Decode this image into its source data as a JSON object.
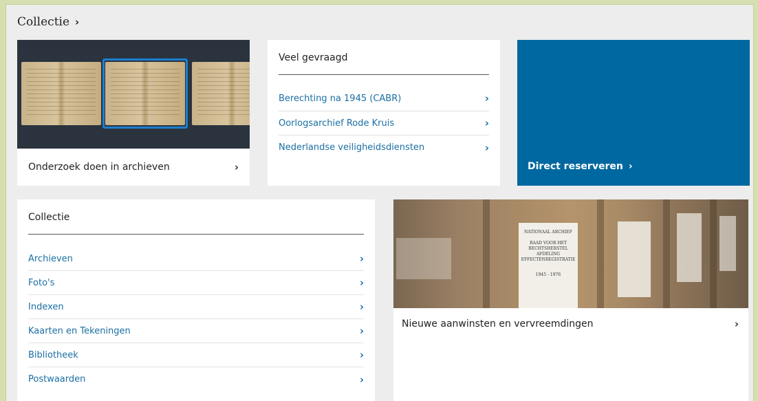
{
  "page": {
    "title": "Collectie",
    "title_chevron": "›"
  },
  "research_card": {
    "label": "Onderzoek doen in archieven",
    "chevron": "›"
  },
  "veel_gevraagd": {
    "heading": "Veel gevraagd",
    "items": [
      {
        "label": "Berechting na 1945 (CABR)",
        "chevron": "›"
      },
      {
        "label": "Oorlogsarchief Rode Kruis",
        "chevron": "›"
      },
      {
        "label": "Nederlandse veiligheidsdiensten",
        "chevron": "›"
      }
    ]
  },
  "reserve_card": {
    "label": "Direct reserveren",
    "chevron": "›"
  },
  "collectie": {
    "heading": "Collectie",
    "items": [
      {
        "label": "Archieven",
        "chevron": "›"
      },
      {
        "label": "Foto's",
        "chevron": "›"
      },
      {
        "label": "Indexen",
        "chevron": "›"
      },
      {
        "label": "Kaarten en Tekeningen",
        "chevron": "›"
      },
      {
        "label": "Bibliotheek",
        "chevron": "›"
      },
      {
        "label": "Postwaarden",
        "chevron": "›"
      }
    ]
  },
  "nieuw_card": {
    "label": "Nieuwe aanwinsten en vervreemdingen",
    "chevron": "›",
    "box_label": {
      "line1": "NATIONAAL ARCHIEF",
      "line2": "RAAD VOOR HET RECHTSHERSTEL AFDELING EFFECTENREGISTRATIE",
      "line3": "1945 - 1976"
    }
  },
  "colors": {
    "accent_blue": "#0068a0",
    "link_blue": "#1a6fa3",
    "page_bg": "#ededed",
    "outer_bg": "#d5dfb0"
  }
}
